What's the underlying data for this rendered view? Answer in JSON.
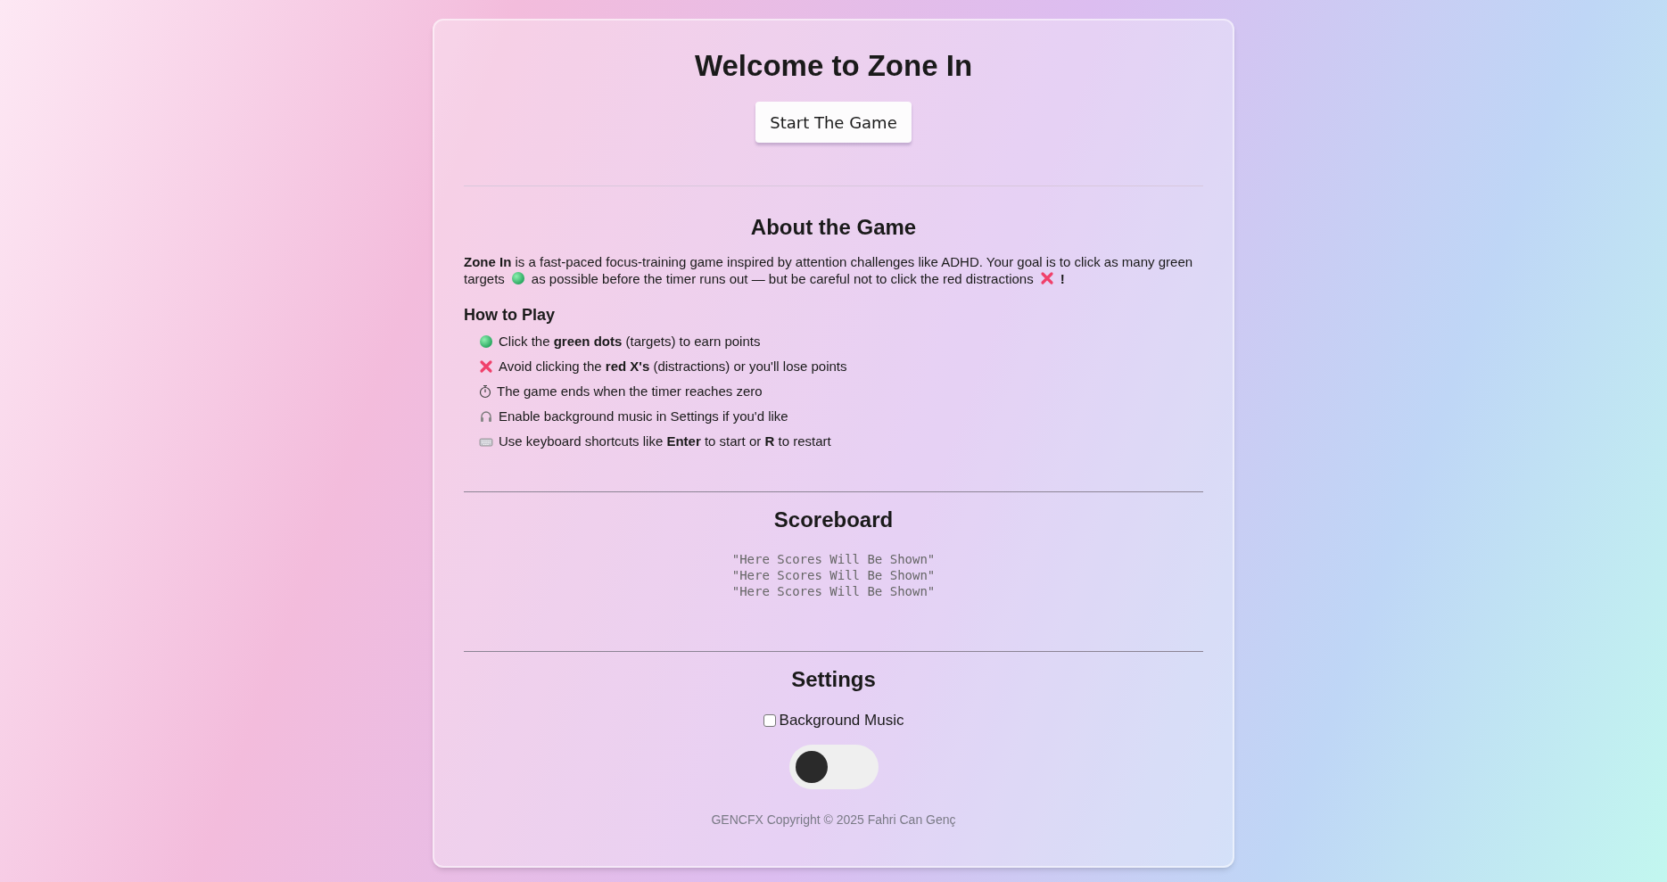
{
  "title": "Welcome to Zone In",
  "start_button": "Start The Game",
  "about": {
    "heading": "About the Game",
    "intro": [
      {
        "kind": "text",
        "text": "**Zone In** is a fast-paced focus-training game inspired by attention challenges like ADHD. Your goal is to click as many green"
      },
      {
        "kind": "break"
      },
      {
        "kind": "text",
        "text": "targets"
      },
      {
        "kind": "green-dot"
      },
      {
        "kind": "text",
        "text": "as possible before the timer runs out — but be careful not to click the red distractions"
      },
      {
        "kind": "red-x"
      },
      {
        "kind": "text",
        "text": "**!**"
      }
    ],
    "how_to_heading": "How to Play",
    "steps": [
      {
        "kind": "green-dot",
        "text": "Click the **green dots** (targets) to earn points"
      },
      {
        "kind": "red-x",
        "text": "Avoid clicking the **red X's** (distractions) or you'll lose points"
      },
      {
        "kind": "stopwatch",
        "text": "The game ends when the timer reaches zero"
      },
      {
        "kind": "headphones",
        "text": "Enable background music in Settings if you'd like"
      },
      {
        "kind": "keyboard",
        "text": "Use keyboard shortcuts like **Enter** to start or **R** to restart"
      }
    ]
  },
  "scoreboard": {
    "heading": "Scoreboard",
    "lines": [
      "\"Here Scores Will Be Shown\"",
      "\"Here Scores Will Be Shown\"",
      "\"Here Scores Will Be Shown\""
    ]
  },
  "settings": {
    "heading": "Settings",
    "checkbox": {
      "label": "Background Music",
      "checked": false
    },
    "toggle": {
      "on": false
    }
  },
  "footer": "GENCFX Copyright © 2025 Fahri Can Genç"
}
